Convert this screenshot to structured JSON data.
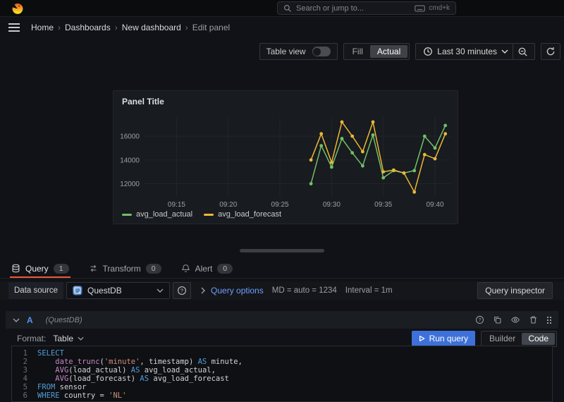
{
  "topbar": {
    "search": {
      "placeholder": "Search or jump to...",
      "shortcut": "cmd+k"
    }
  },
  "breadcrumb": {
    "separator": "›",
    "items": [
      "Home",
      "Dashboards",
      "New dashboard",
      "Edit panel"
    ]
  },
  "controls": {
    "table_view_label": "Table view",
    "fill_label": "Fill",
    "actual_label": "Actual",
    "time_range_label": "Last 30 minutes"
  },
  "panel": {
    "title": "Panel Title"
  },
  "chart_data": {
    "type": "line",
    "title": "Panel Title",
    "x_labels": [
      "09:28",
      "09:29",
      "09:30",
      "09:31",
      "09:32",
      "09:33",
      "09:34",
      "09:35",
      "09:36",
      "09:37",
      "09:38",
      "09:39",
      "09:40",
      "09:41"
    ],
    "x_minutes": [
      28,
      29,
      30,
      31,
      32,
      33,
      34,
      35,
      36,
      37,
      38,
      39,
      40,
      41
    ],
    "x_tick_minutes": [
      15,
      20,
      25,
      30,
      35,
      40
    ],
    "x_tick_labels": [
      "09:15",
      "09:20",
      "09:25",
      "09:30",
      "09:35",
      "09:40"
    ],
    "xlim_minutes": [
      11.9,
      41.5
    ],
    "yticks": [
      12000,
      14000,
      16000
    ],
    "ylim": [
      10900,
      17550
    ],
    "grid": true,
    "legend_position": "bottom-left",
    "series": [
      {
        "name": "avg_load_actual",
        "color": "#73BF69",
        "values": [
          12000,
          15200,
          13400,
          15800,
          14600,
          13500,
          16100,
          12500,
          13100,
          12900,
          13100,
          16000,
          15000,
          16900
        ]
      },
      {
        "name": "avg_load_forecast",
        "color": "#EAB839",
        "values": [
          14000,
          16200,
          13800,
          17200,
          16000,
          14700,
          17200,
          13000,
          13150,
          12900,
          11300,
          14450,
          14100,
          16200
        ]
      }
    ]
  },
  "tabs": [
    {
      "label": "Query",
      "badge": "1",
      "active": true
    },
    {
      "label": "Transform",
      "badge": "0",
      "active": false
    },
    {
      "label": "Alert",
      "badge": "0",
      "active": false
    }
  ],
  "datasource": {
    "label": "Data source",
    "name": "QuestDB",
    "query_options_label": "Query options",
    "md_summary": "MD = auto = 1234",
    "interval_summary": "Interval = 1m",
    "query_inspector_label": "Query inspector"
  },
  "query": {
    "ref_id": "A",
    "datasource_hint": "(QuestDB)",
    "format_label": "Format:",
    "format_value": "Table",
    "run_query_label": "Run query",
    "builder_label": "Builder",
    "code_label": "Code",
    "code_lines": [
      {
        "num": "1",
        "tokens": [
          {
            "t": "SELECT",
            "c": "kw"
          }
        ]
      },
      {
        "num": "2",
        "tokens": [
          {
            "t": "    ",
            "c": "pl"
          },
          {
            "t": "date_trunc",
            "c": "fn"
          },
          {
            "t": "(",
            "c": "pl"
          },
          {
            "t": "'minute'",
            "c": "str"
          },
          {
            "t": ", timestamp) ",
            "c": "pl"
          },
          {
            "t": "AS",
            "c": "kw"
          },
          {
            "t": " minute,",
            "c": "pl"
          }
        ]
      },
      {
        "num": "3",
        "tokens": [
          {
            "t": "    ",
            "c": "pl"
          },
          {
            "t": "AVG",
            "c": "fn"
          },
          {
            "t": "(load_actual) ",
            "c": "pl"
          },
          {
            "t": "AS",
            "c": "kw"
          },
          {
            "t": " avg_load_actual,",
            "c": "pl"
          }
        ]
      },
      {
        "num": "4",
        "tokens": [
          {
            "t": "    ",
            "c": "pl"
          },
          {
            "t": "AVG",
            "c": "fn"
          },
          {
            "t": "(load_forecast) ",
            "c": "pl"
          },
          {
            "t": "AS",
            "c": "kw"
          },
          {
            "t": " avg_load_forecast",
            "c": "pl"
          }
        ]
      },
      {
        "num": "5",
        "tokens": [
          {
            "t": "FROM",
            "c": "kw"
          },
          {
            "t": " sensor",
            "c": "pl"
          }
        ]
      },
      {
        "num": "6",
        "tokens": [
          {
            "t": "WHERE",
            "c": "kw"
          },
          {
            "t": " country = ",
            "c": "pl"
          },
          {
            "t": "'NL'",
            "c": "str"
          }
        ]
      }
    ]
  },
  "icons": {
    "grafana-logo": "orange-flame-swirl",
    "search": "magnifier",
    "keyboard": "keyboard-outline",
    "menu": "hamburger",
    "clock": "clock-face",
    "zoom-out": "magnifier-minus",
    "refresh": "circular-arrow",
    "query-tab": "database-cylinder",
    "transform-tab": "swap-arrows",
    "alert-tab": "bell",
    "datasource-logo": "questdb-blue-square",
    "help": "question-circle",
    "duplicate": "copy-sheets",
    "hide": "eye",
    "remove": "trash-can",
    "drag": "grip-dots",
    "run": "play-triangle",
    "caret": "chevron-down"
  },
  "colors": {
    "background_canvas": "#111217",
    "background_panel": "#181B1F",
    "series_green": "#73BF69",
    "series_yellow": "#EAB839",
    "tab_active_underline": "#EB5B32",
    "run_button_blue": "#3D71D9",
    "link_blue": "#6E9FFF",
    "ref_id_blue": "#5794F2",
    "sql_keyword": "#569CD6",
    "sql_function": "#C586C0",
    "sql_string": "#CE9178",
    "sql_plain": "#D4D4D4"
  }
}
